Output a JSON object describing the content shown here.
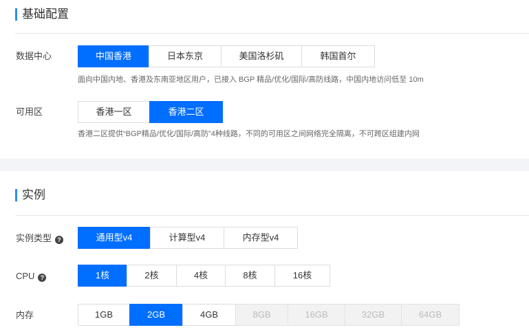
{
  "basic": {
    "title": "基础配置",
    "datacenter": {
      "label": "数据中心",
      "options": [
        "中国香港",
        "日本东京",
        "美国洛杉矶",
        "韩国首尔"
      ],
      "selected": "中国香港",
      "hint": "面向中国内地、香港及东南亚地区用户，已接入 BGP 精品/优化/国际/高防线路，中国内地访问低至 10m"
    },
    "zone": {
      "label": "可用区",
      "options": [
        "香港一区",
        "香港二区"
      ],
      "selected": "香港二区",
      "hint": "香港二区提供“BGP精品/优化/国际/高防”4种线路，不同的可用区之间网络完全隔离，不可跨区组建内网"
    }
  },
  "instance": {
    "title": "实例",
    "type": {
      "label": "实例类型",
      "help_icon": "question-circle-icon",
      "options": [
        "通用型v4",
        "计算型v4",
        "内存型v4"
      ],
      "selected": "通用型v4"
    },
    "cpu": {
      "label": "CPU",
      "help_icon": "question-circle-icon",
      "options": [
        "1核",
        "2核",
        "4核",
        "8核",
        "16核"
      ],
      "selected": "1核"
    },
    "memory": {
      "label": "内存",
      "options": [
        "1GB",
        "2GB",
        "4GB",
        "8GB",
        "16GB",
        "32GB",
        "64GB"
      ],
      "selected": "2GB",
      "disabled": [
        "8GB",
        "16GB",
        "32GB",
        "64GB"
      ]
    }
  },
  "colors": {
    "accent": "#006eff",
    "title_bar": "#2d8cf0",
    "disabled_bg": "#f2f2f2"
  }
}
